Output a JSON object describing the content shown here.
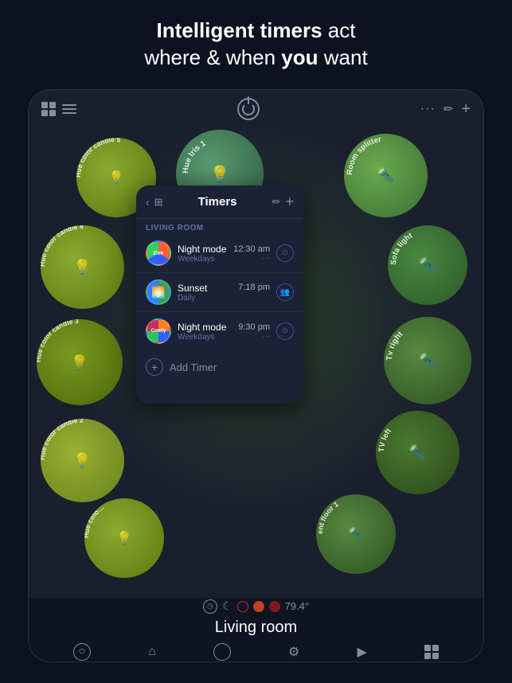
{
  "headline": {
    "line1_bold": "Intelligent timers",
    "line1_rest": " act",
    "line2_start": "where & when ",
    "line2_bold": "you",
    "line2_end": " want"
  },
  "device": {
    "topbar": {
      "icons_left": [
        "grid",
        "menu"
      ],
      "center_icon": "power",
      "icons_right": [
        "dots",
        "edit",
        "plus"
      ]
    },
    "room_name": "Living room",
    "temperature": "79.4°",
    "bottom_nav": [
      "power",
      "home",
      "circle",
      "settings",
      "play"
    ]
  },
  "timers_panel": {
    "title": "Timers",
    "section_label": "LIVING ROOM",
    "back_icon": "chevron-left",
    "settings_icon": "sliders",
    "edit_icon": "pencil",
    "add_icon": "+",
    "timers": [
      {
        "id": 1,
        "badge": "Evening",
        "name": "Night mode",
        "schedule": "Weekdays",
        "time": "12:30 am",
        "has_dots": true,
        "action_icon": "power"
      },
      {
        "id": 2,
        "badge": "🌅",
        "name": "Sunset",
        "schedule": "Daily",
        "time": "7:18 pm",
        "has_dots": false,
        "action_icon": "person-group"
      },
      {
        "id": 3,
        "badge": "Comfy",
        "name": "Night mode",
        "schedule": "Weekdays",
        "time": "9:30 pm",
        "has_dots": true,
        "action_icon": "power"
      }
    ],
    "add_timer_label": "Add Timer"
  },
  "lights": [
    {
      "id": "hue-iris",
      "label": "Hue Iris 1",
      "icon": "💡"
    },
    {
      "id": "room-splitter",
      "label": "Room splitter",
      "icon": "🔦"
    },
    {
      "id": "sofa-light",
      "label": "Sofa light",
      "icon": "🔦"
    },
    {
      "id": "tv-right",
      "label": "Tv right",
      "icon": "🔦"
    },
    {
      "id": "tv-left",
      "label": "TV left",
      "icon": "🔦"
    },
    {
      "id": "ent-floor",
      "label": "ent floor 1",
      "icon": "🔦"
    },
    {
      "id": "hue-candle5",
      "label": "Hue color candle 5",
      "icon": "💡"
    },
    {
      "id": "hue-candle4",
      "label": "Hue color candle 4",
      "icon": "💡"
    },
    {
      "id": "hue-candle3",
      "label": "Hue color candle 3",
      "icon": "💡"
    },
    {
      "id": "hue-candle2",
      "label": "Hue color candle 2",
      "icon": "💡"
    },
    {
      "id": "hue-color",
      "label": "Hue colo…",
      "icon": "💡"
    }
  ],
  "colors": {
    "bg": "#0d1120",
    "device_bg": "#1a1f2e",
    "panel_bg": "#1c2235",
    "accent_blue": "#6080ff",
    "green_light": "#5a9a70",
    "yellow_green": "#8aaa30"
  }
}
